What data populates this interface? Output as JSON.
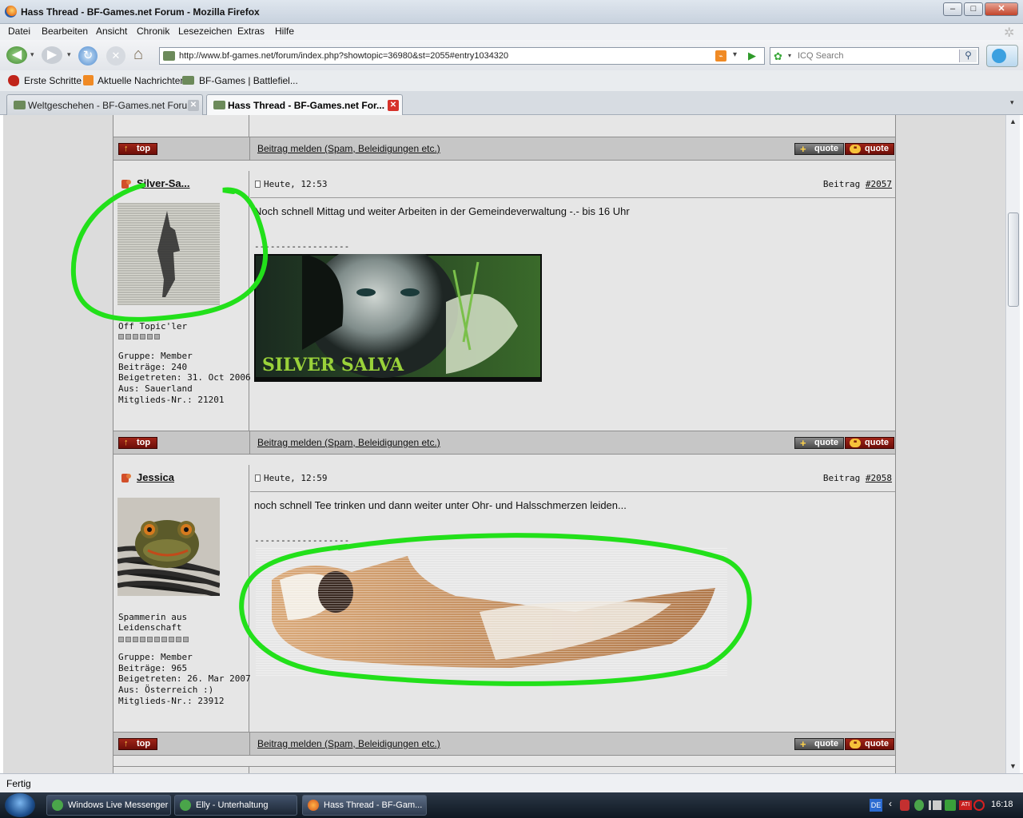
{
  "window": {
    "title": "Hass Thread - BF-Games.net Forum - Mozilla Firefox",
    "minimize": "–",
    "maximize": "□",
    "close": "✕"
  },
  "menu": [
    "Datei",
    "Bearbeiten",
    "Ansicht",
    "Chronik",
    "Lesezeichen",
    "Extras",
    "Hilfe"
  ],
  "nav": {
    "url": "http://www.bf-games.net/forum/index.php?showtopic=36980&st=2055#entry1034320",
    "search_placeholder": "ICQ Search"
  },
  "bookmarks": [
    "Erste Schritte",
    "Aktuelle Nachrichten",
    "BF-Games | Battlefiel..."
  ],
  "tabs": [
    {
      "label": "Weltgeschehen - BF-Games.net Forum",
      "active": false
    },
    {
      "label": "Hass Thread - BF-Games.net For...",
      "active": true
    }
  ],
  "post_actions": {
    "top": "top",
    "report": "Beitrag melden (Spam, Beleidigungen etc.)",
    "quote_add": "quote",
    "quote": "quote"
  },
  "posts": [
    {
      "author": "Silver-Sa...",
      "date": "Heute, 12:53",
      "post_label": "Beitrag",
      "post_number": "#2057",
      "text": "Noch schnell Mittag und weiter Arbeiten in der Gemeindeverwaltung -.- bis 16 Uhr",
      "signature_rule": "------------------",
      "signature_banner_text": "SILVER SALVA",
      "rank": "Off Topic'ler",
      "rank_pips": 6,
      "group": "Gruppe: Member",
      "posts": "Beiträge: 240",
      "joined": "Beigetreten: 31. Oct 2006",
      "from": "Aus: Sauerland",
      "member_no": "Mitglieds-Nr.: 21201"
    },
    {
      "author": "Jessica",
      "date": "Heute, 12:59",
      "post_label": "Beitrag",
      "post_number": "#2058",
      "text": "noch schnell Tee trinken und dann weiter unter Ohr- und Halsschmerzen leiden...",
      "signature_rule": "------------------",
      "rank_line1": "Spammerin aus",
      "rank_line2": "Leidenschaft",
      "rank_pips": 10,
      "group": "Gruppe: Member",
      "posts": "Beiträge: 965",
      "joined": "Beigetreten: 26. Mar 2007",
      "from": "Aus: Österreich :)",
      "member_no": "Mitglieds-Nr.: 23912"
    }
  ],
  "status": "Fertig",
  "taskbar": {
    "items": [
      "Windows Live Messenger",
      "Elly - Unterhaltung",
      "Hass Thread - BF-Gam..."
    ],
    "lang": "DE",
    "clock": "16:18"
  },
  "colors": {
    "highlight_circle": "#22e01a"
  }
}
